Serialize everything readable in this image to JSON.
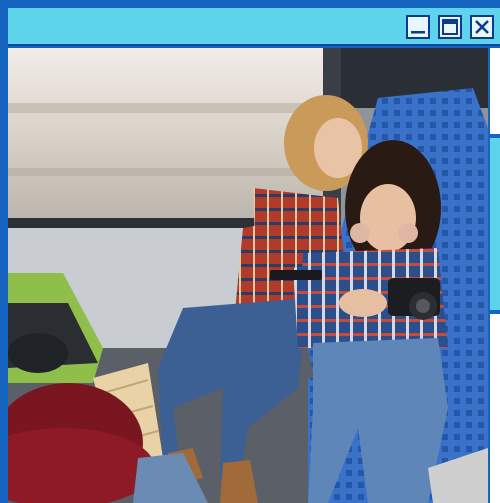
{
  "window": {
    "title": "",
    "controls": {
      "minimize_icon": "minimize-icon",
      "maximize_icon": "maximize-icon",
      "close_icon": "close-icon"
    }
  },
  "content": {
    "image_subject": "two-women-on-train-photo"
  },
  "colors": {
    "titlebar": "#5dd3ec",
    "frame": "#1565c0",
    "control_border": "#0d3a8c"
  }
}
